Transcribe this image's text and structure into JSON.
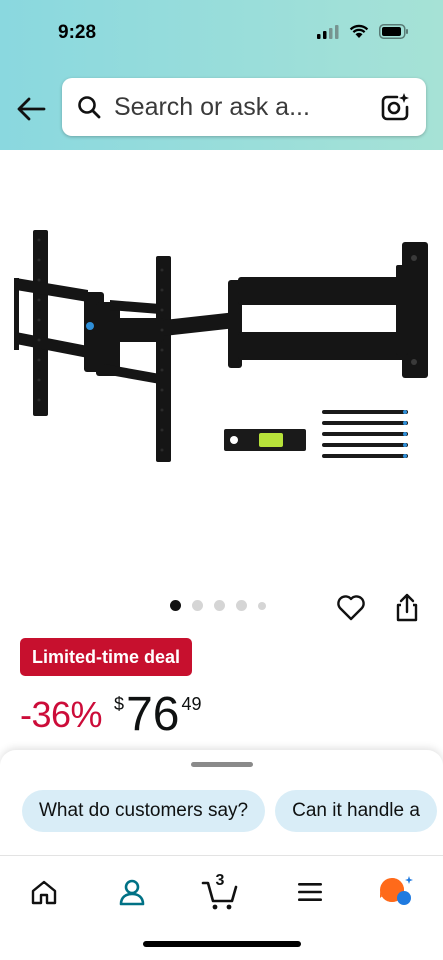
{
  "status_bar": {
    "time": "9:28",
    "icons": [
      "cellular-signal-icon",
      "wifi-icon",
      "battery-icon"
    ]
  },
  "header": {
    "back_icon": "arrow-left-icon",
    "search": {
      "placeholder": "Search or ask a...",
      "icon": "search-icon",
      "camera_icon": "camera-sparkle-icon"
    },
    "background_gradient": [
      "#8ad8df",
      "#a6e2d6"
    ]
  },
  "product": {
    "image": "tv-wall-mount-full-motion-arm",
    "carousel": {
      "count": 5,
      "active_index": 0
    },
    "wishlist_icon": "heart-icon",
    "share_icon": "share-icon",
    "deal_badge": "Limited-time deal",
    "discount": "-36%",
    "price": {
      "currency": "$",
      "whole": "76",
      "fraction": "49"
    },
    "colors": {
      "deal": "#c7102e",
      "discount": "#cc0c39"
    }
  },
  "suggestions": {
    "chips": [
      "What do customers say?",
      "Can it handle a"
    ]
  },
  "bottom_nav": {
    "items": [
      {
        "name": "home",
        "icon": "home-icon"
      },
      {
        "name": "account",
        "icon": "person-icon"
      },
      {
        "name": "cart",
        "icon": "cart-icon",
        "count": "3"
      },
      {
        "name": "menu",
        "icon": "hamburger-icon"
      },
      {
        "name": "rufus",
        "icon": "rufus-ai-icon"
      }
    ],
    "accent": "#007185"
  }
}
